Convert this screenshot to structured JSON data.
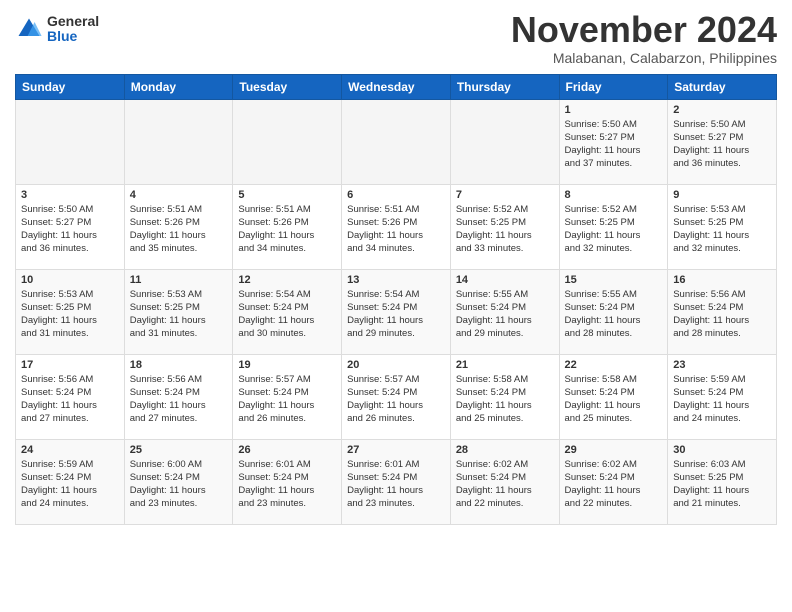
{
  "header": {
    "logo": {
      "line1": "General",
      "line2": "Blue"
    },
    "title": "November 2024",
    "location": "Malabanan, Calabarzon, Philippines"
  },
  "weekdays": [
    "Sunday",
    "Monday",
    "Tuesday",
    "Wednesday",
    "Thursday",
    "Friday",
    "Saturday"
  ],
  "weeks": [
    [
      {
        "day": "",
        "info": ""
      },
      {
        "day": "",
        "info": ""
      },
      {
        "day": "",
        "info": ""
      },
      {
        "day": "",
        "info": ""
      },
      {
        "day": "",
        "info": ""
      },
      {
        "day": "1",
        "info": "Sunrise: 5:50 AM\nSunset: 5:27 PM\nDaylight: 11 hours\nand 37 minutes."
      },
      {
        "day": "2",
        "info": "Sunrise: 5:50 AM\nSunset: 5:27 PM\nDaylight: 11 hours\nand 36 minutes."
      }
    ],
    [
      {
        "day": "3",
        "info": "Sunrise: 5:50 AM\nSunset: 5:27 PM\nDaylight: 11 hours\nand 36 minutes."
      },
      {
        "day": "4",
        "info": "Sunrise: 5:51 AM\nSunset: 5:26 PM\nDaylight: 11 hours\nand 35 minutes."
      },
      {
        "day": "5",
        "info": "Sunrise: 5:51 AM\nSunset: 5:26 PM\nDaylight: 11 hours\nand 34 minutes."
      },
      {
        "day": "6",
        "info": "Sunrise: 5:51 AM\nSunset: 5:26 PM\nDaylight: 11 hours\nand 34 minutes."
      },
      {
        "day": "7",
        "info": "Sunrise: 5:52 AM\nSunset: 5:25 PM\nDaylight: 11 hours\nand 33 minutes."
      },
      {
        "day": "8",
        "info": "Sunrise: 5:52 AM\nSunset: 5:25 PM\nDaylight: 11 hours\nand 32 minutes."
      },
      {
        "day": "9",
        "info": "Sunrise: 5:53 AM\nSunset: 5:25 PM\nDaylight: 11 hours\nand 32 minutes."
      }
    ],
    [
      {
        "day": "10",
        "info": "Sunrise: 5:53 AM\nSunset: 5:25 PM\nDaylight: 11 hours\nand 31 minutes."
      },
      {
        "day": "11",
        "info": "Sunrise: 5:53 AM\nSunset: 5:25 PM\nDaylight: 11 hours\nand 31 minutes."
      },
      {
        "day": "12",
        "info": "Sunrise: 5:54 AM\nSunset: 5:24 PM\nDaylight: 11 hours\nand 30 minutes."
      },
      {
        "day": "13",
        "info": "Sunrise: 5:54 AM\nSunset: 5:24 PM\nDaylight: 11 hours\nand 29 minutes."
      },
      {
        "day": "14",
        "info": "Sunrise: 5:55 AM\nSunset: 5:24 PM\nDaylight: 11 hours\nand 29 minutes."
      },
      {
        "day": "15",
        "info": "Sunrise: 5:55 AM\nSunset: 5:24 PM\nDaylight: 11 hours\nand 28 minutes."
      },
      {
        "day": "16",
        "info": "Sunrise: 5:56 AM\nSunset: 5:24 PM\nDaylight: 11 hours\nand 28 minutes."
      }
    ],
    [
      {
        "day": "17",
        "info": "Sunrise: 5:56 AM\nSunset: 5:24 PM\nDaylight: 11 hours\nand 27 minutes."
      },
      {
        "day": "18",
        "info": "Sunrise: 5:56 AM\nSunset: 5:24 PM\nDaylight: 11 hours\nand 27 minutes."
      },
      {
        "day": "19",
        "info": "Sunrise: 5:57 AM\nSunset: 5:24 PM\nDaylight: 11 hours\nand 26 minutes."
      },
      {
        "day": "20",
        "info": "Sunrise: 5:57 AM\nSunset: 5:24 PM\nDaylight: 11 hours\nand 26 minutes."
      },
      {
        "day": "21",
        "info": "Sunrise: 5:58 AM\nSunset: 5:24 PM\nDaylight: 11 hours\nand 25 minutes."
      },
      {
        "day": "22",
        "info": "Sunrise: 5:58 AM\nSunset: 5:24 PM\nDaylight: 11 hours\nand 25 minutes."
      },
      {
        "day": "23",
        "info": "Sunrise: 5:59 AM\nSunset: 5:24 PM\nDaylight: 11 hours\nand 24 minutes."
      }
    ],
    [
      {
        "day": "24",
        "info": "Sunrise: 5:59 AM\nSunset: 5:24 PM\nDaylight: 11 hours\nand 24 minutes."
      },
      {
        "day": "25",
        "info": "Sunrise: 6:00 AM\nSunset: 5:24 PM\nDaylight: 11 hours\nand 23 minutes."
      },
      {
        "day": "26",
        "info": "Sunrise: 6:01 AM\nSunset: 5:24 PM\nDaylight: 11 hours\nand 23 minutes."
      },
      {
        "day": "27",
        "info": "Sunrise: 6:01 AM\nSunset: 5:24 PM\nDaylight: 11 hours\nand 23 minutes."
      },
      {
        "day": "28",
        "info": "Sunrise: 6:02 AM\nSunset: 5:24 PM\nDaylight: 11 hours\nand 22 minutes."
      },
      {
        "day": "29",
        "info": "Sunrise: 6:02 AM\nSunset: 5:24 PM\nDaylight: 11 hours\nand 22 minutes."
      },
      {
        "day": "30",
        "info": "Sunrise: 6:03 AM\nSunset: 5:25 PM\nDaylight: 11 hours\nand 21 minutes."
      }
    ]
  ]
}
